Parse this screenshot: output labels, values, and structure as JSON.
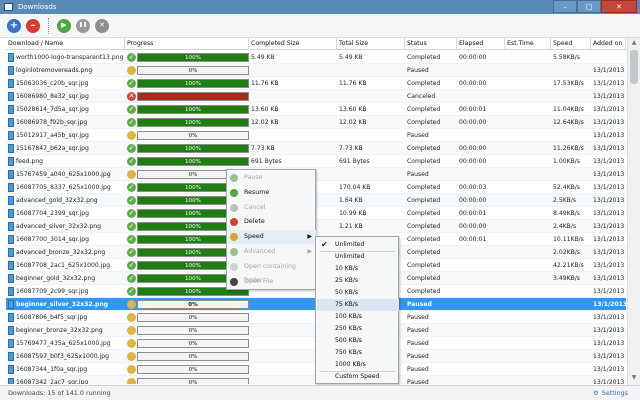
{
  "window": {
    "title": "Downloads",
    "min": "–",
    "max": "□",
    "close": "✕"
  },
  "toolbar": {
    "add": "+",
    "remove": "–",
    "start": "▶",
    "pause": "❚❚",
    "stop": "✕"
  },
  "columns": [
    "Download / Name",
    "Progress",
    "Completed Size",
    "Total Size",
    "Status",
    "Elapsed",
    "Est.Time",
    "Speed",
    "Added on"
  ],
  "rows": [
    {
      "name": "worth1000-logo-transparent13.png",
      "icon": "ok",
      "bar": "g",
      "pct": 1.0,
      "progress": "100%",
      "completed": "5.49 KB",
      "total": "5.49 KB",
      "status": "Completed",
      "elapsed": "00:00:00",
      "est": "",
      "speed": "5.58KB/s",
      "added": ""
    },
    {
      "name": "loginlotremovereads.png",
      "icon": "pause",
      "bar": "empty",
      "pct": 0.0,
      "progress": "0%",
      "completed": "",
      "total": "",
      "status": "Paused",
      "elapsed": "",
      "est": "",
      "speed": "",
      "added": "13/1/2013"
    },
    {
      "name": "15063036_c20b_sqr.jpg",
      "icon": "ok",
      "bar": "g",
      "pct": 1.0,
      "progress": "100%",
      "completed": "11.76 KB",
      "total": "11.76 KB",
      "status": "Completed",
      "elapsed": "00:00:00",
      "est": "",
      "speed": "17.53KB/s",
      "added": "13/1/2013"
    },
    {
      "name": "16086980_8e32_sqr.jpg",
      "icon": "err",
      "bar": "r",
      "pct": 1.0,
      "progress": "",
      "completed": "",
      "total": "",
      "status": "Canceled",
      "elapsed": "",
      "est": "",
      "speed": "",
      "added": "13/1/2013"
    },
    {
      "name": "15028614_7d5a_sqr.jpg",
      "icon": "ok",
      "bar": "g",
      "pct": 1.0,
      "progress": "100%",
      "completed": "13.60 KB",
      "total": "13.60 KB",
      "status": "Completed",
      "elapsed": "00:00:01",
      "est": "",
      "speed": "11.04KB/s",
      "added": "13/1/2013"
    },
    {
      "name": "16086978_f92b_sqr.jpg",
      "icon": "ok",
      "bar": "g",
      "pct": 1.0,
      "progress": "100%",
      "completed": "12.02 KB",
      "total": "12.02 KB",
      "status": "Completed",
      "elapsed": "00:00:00",
      "est": "",
      "speed": "12.64KB/s",
      "added": "13/1/2013"
    },
    {
      "name": "15012917_a45b_sqr.jpg",
      "icon": "pause",
      "bar": "empty",
      "pct": 0.0,
      "progress": "0%",
      "completed": "",
      "total": "",
      "status": "Paused",
      "elapsed": "",
      "est": "",
      "speed": "",
      "added": "13/1/2013"
    },
    {
      "name": "15167847_b62a_sqr.jpg",
      "icon": "ok",
      "bar": "g",
      "pct": 1.0,
      "progress": "100%",
      "completed": "7.73 KB",
      "total": "7.73 KB",
      "status": "Completed",
      "elapsed": "00:00:00",
      "est": "",
      "speed": "11.26KB/s",
      "added": "13/1/2013"
    },
    {
      "name": "feed.png",
      "icon": "ok",
      "bar": "g",
      "pct": 1.0,
      "progress": "100%",
      "completed": "691 Bytes",
      "total": "691 Bytes",
      "status": "Completed",
      "elapsed": "00:00:00",
      "est": "",
      "speed": "1.00KB/s",
      "added": "13/1/2013"
    },
    {
      "name": "15767459_a040_625x1000.jpg",
      "icon": "pause",
      "bar": "empty",
      "pct": 0.0,
      "progress": "0%",
      "completed": "",
      "total": "",
      "status": "Paused",
      "elapsed": "",
      "est": "",
      "speed": "",
      "added": "13/1/2013"
    },
    {
      "name": "16087705_8337_625x1000.jpg",
      "icon": "ok",
      "bar": "g",
      "pct": 1.0,
      "progress": "100%",
      "completed": "",
      "total": "170.04 KB",
      "status": "Completed",
      "elapsed": "00:00:03",
      "est": "",
      "speed": "52.4KB/s",
      "added": "13/1/2013"
    },
    {
      "name": "advanced_gold_32x32.png",
      "icon": "ok",
      "bar": "g",
      "pct": 1.0,
      "progress": "100%",
      "completed": "",
      "total": "1.64 KB",
      "status": "Completed",
      "elapsed": "00:00:00",
      "est": "",
      "speed": "2.5KB/s",
      "added": "13/1/2013"
    },
    {
      "name": "16087704_2399_sqr.jpg",
      "icon": "ok",
      "bar": "g",
      "pct": 1.0,
      "progress": "100%",
      "completed": "",
      "total": "10.99 KB",
      "status": "Completed",
      "elapsed": "00:00:01",
      "est": "",
      "speed": "8.49KB/s",
      "added": "13/1/2013"
    },
    {
      "name": "advanced_silver_32x32.png",
      "icon": "ok",
      "bar": "g",
      "pct": 1.0,
      "progress": "100%",
      "completed": "",
      "total": "1.21 KB",
      "status": "Completed",
      "elapsed": "00:00:00",
      "est": "",
      "speed": "2.4KB/s",
      "added": "13/1/2013"
    },
    {
      "name": "16087700_3014_sqr.jpg",
      "icon": "ok",
      "bar": "g",
      "pct": 1.0,
      "progress": "100%",
      "completed": "",
      "total": "",
      "status": "Completed",
      "elapsed": "00:00:01",
      "est": "",
      "speed": "10.11KB/s",
      "added": "13/1/2013"
    },
    {
      "name": "advanced_bronze_32x32.png",
      "icon": "ok",
      "bar": "g",
      "pct": 1.0,
      "progress": "100%",
      "completed": "",
      "total": "",
      "status": "Completed",
      "elapsed": "",
      "est": "",
      "speed": "2.02KB/s",
      "added": "13/1/2013"
    },
    {
      "name": "16087708_2ac1_625x1000.jpg",
      "icon": "ok",
      "bar": "g",
      "pct": 1.0,
      "progress": "100%",
      "completed": "",
      "total": "",
      "status": "Completed",
      "elapsed": "",
      "est": "",
      "speed": "42.21KB/s",
      "added": "13/1/2013"
    },
    {
      "name": "beginner_gold_32x32.png",
      "icon": "ok",
      "bar": "g",
      "pct": 1.0,
      "progress": "100%",
      "completed": "",
      "total": "",
      "status": "Completed",
      "elapsed": "",
      "est": "",
      "speed": "3.49KB/s",
      "added": "13/1/2013"
    },
    {
      "name": "16087709_2c99_sqr.jpg",
      "icon": "ok",
      "bar": "g",
      "pct": 1.0,
      "progress": "100%",
      "completed": "",
      "total": "",
      "status": "Completed",
      "elapsed": "",
      "est": "",
      "speed": "",
      "added": "13/1/2013"
    },
    {
      "name": "beginner_silver_32x32.png",
      "icon": "pause",
      "bar": "empty",
      "pct": 0.0,
      "progress": "0%",
      "completed": "",
      "total": "",
      "status": "Paused",
      "elapsed": "",
      "est": "",
      "speed": "",
      "added": "13/1/2013",
      "selected": true
    },
    {
      "name": "16087806_b4f5_sqr.jpg",
      "icon": "pause",
      "bar": "empty",
      "pct": 0.0,
      "progress": "0%",
      "completed": "",
      "total": "",
      "status": "Paused",
      "elapsed": "",
      "est": "",
      "speed": "",
      "added": "13/1/2013"
    },
    {
      "name": "beginner_bronze_32x32.png",
      "icon": "pause",
      "bar": "empty",
      "pct": 0.0,
      "progress": "0%",
      "completed": "",
      "total": "",
      "status": "Paused",
      "elapsed": "",
      "est": "",
      "speed": "",
      "added": "13/1/2013"
    },
    {
      "name": "15769477_435a_625x1000.jpg",
      "icon": "pause",
      "bar": "empty",
      "pct": 0.0,
      "progress": "0%",
      "completed": "",
      "total": "",
      "status": "Paused",
      "elapsed": "",
      "est": "",
      "speed": "",
      "added": "13/1/2013"
    },
    {
      "name": "16087597_b0f3_625x1000.jpg",
      "icon": "pause",
      "bar": "empty",
      "pct": 0.0,
      "progress": "0%",
      "completed": "",
      "total": "",
      "status": "Paused",
      "elapsed": "",
      "est": "",
      "speed": "",
      "added": "13/1/2013"
    },
    {
      "name": "16087344_1f0a_sqr.jpg",
      "icon": "pause",
      "bar": "empty",
      "pct": 0.0,
      "progress": "0%",
      "completed": "",
      "total": "",
      "status": "Paused",
      "elapsed": "",
      "est": "",
      "speed": "",
      "added": "13/1/2013"
    },
    {
      "name": "16087342_2ac7_sqr.jpg",
      "icon": "pause",
      "bar": "empty",
      "pct": 0.0,
      "progress": "0%",
      "completed": "",
      "total": "",
      "status": "Paused",
      "elapsed": "",
      "est": "",
      "speed": "",
      "added": "13/1/2013"
    }
  ],
  "context_menu": {
    "items": [
      {
        "label": "Pause",
        "icon": "pause-icon",
        "disabled": true,
        "color": "#9bbf88"
      },
      {
        "label": "Resume",
        "icon": "resume-icon",
        "disabled": false,
        "color": "#4fa93b"
      },
      {
        "label": "Cancel",
        "icon": "cancel-icon",
        "disabled": true,
        "color": "#c0c0c0"
      },
      {
        "label": "Delete",
        "icon": "delete-icon",
        "disabled": false,
        "color": "#d94133"
      },
      {
        "label": "Speed",
        "icon": "speed-icon",
        "disabled": false,
        "color": "#d9a43a",
        "submenu": true
      },
      {
        "label": "Advanced",
        "icon": "advanced-icon",
        "disabled": true,
        "color": "#9bbf88",
        "submenu": true
      },
      {
        "label": "Open containing folder",
        "icon": "folder-icon",
        "disabled": true,
        "color": "#cfcfcf"
      },
      {
        "label": "Open File",
        "icon": "open-file-icon",
        "disabled": true,
        "color": "#444"
      }
    ]
  },
  "speed_submenu": {
    "items": [
      "Unlimited",
      "Unlimited",
      "10 KB/s",
      "25 KB/s",
      "50 KB/s",
      "75 KB/s",
      "100 KB/s",
      "250 KB/s",
      "500 KB/s",
      "750 KB/s",
      "1000 KB/s",
      "Custom Speed"
    ],
    "checked_index": 0
  },
  "statusbar": {
    "text": "Downloads: 15 of 141.0 running",
    "settings": "Settings"
  }
}
